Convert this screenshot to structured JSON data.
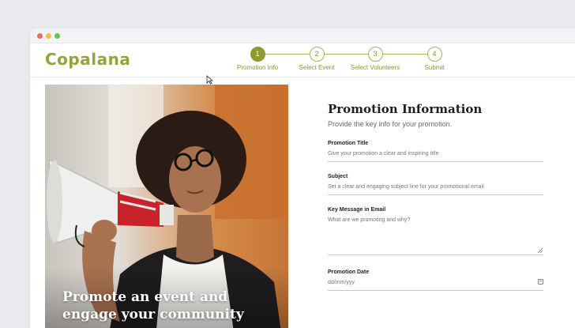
{
  "app": {
    "logo": "Copalana"
  },
  "stepper": {
    "steps": [
      {
        "number": "1",
        "label": "Promotion Info"
      },
      {
        "number": "2",
        "label": "Select Event"
      },
      {
        "number": "3",
        "label": "Select Volunteers"
      },
      {
        "number": "4",
        "label": "Submit"
      }
    ],
    "active_step": 1
  },
  "hero": {
    "caption_line1": "Promote an event and",
    "caption_line2": "engage your community"
  },
  "form": {
    "title": "Promotion Information",
    "subtitle": "Provide the key info for your promotion.",
    "fields": {
      "title": {
        "label": "Promotion Title",
        "placeholder": "Give your promotion a clear and inspiring title"
      },
      "subject": {
        "label": "Subject",
        "placeholder": "Set a clear and engaging subject line for your promotional email"
      },
      "message": {
        "label": "Key Message in Email",
        "placeholder": "What are we promoting and why?"
      },
      "date": {
        "label": "Promotion Date",
        "placeholder": "dd/mm/yyy"
      }
    }
  },
  "colors": {
    "accent": "#8f9a2f",
    "logo": "#98a13a"
  },
  "icons": {
    "calendar": "calendar-icon",
    "cursor": "mouse-cursor-icon"
  }
}
